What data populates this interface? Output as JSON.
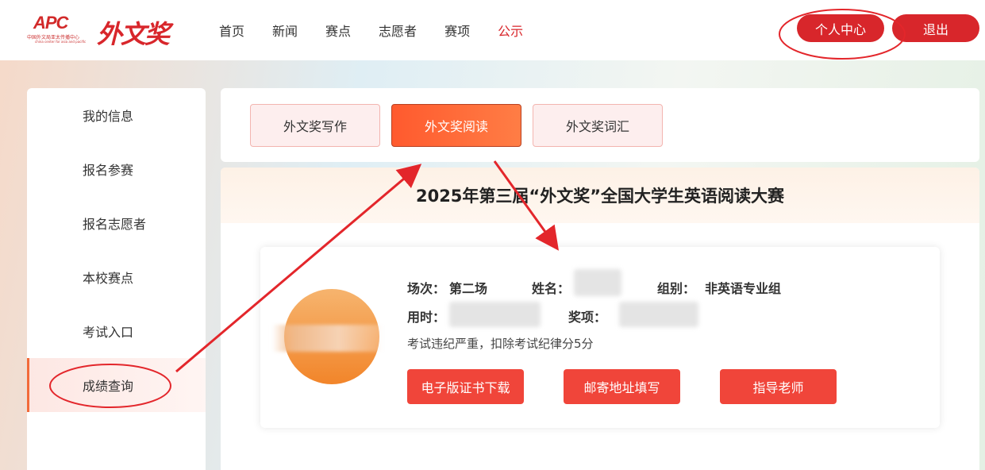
{
  "header": {
    "logo_apc": "APC",
    "logo_apc_sub": "中国外文局亚太传播中心",
    "logo_apc_sub2": "china center for asia and pacific",
    "logo_title": "外文奖",
    "nav": [
      {
        "label": "首页"
      },
      {
        "label": "新闻"
      },
      {
        "label": "赛点"
      },
      {
        "label": "志愿者"
      },
      {
        "label": "赛项"
      },
      {
        "label": "公示"
      }
    ],
    "user_center_label": "个人中心",
    "logout_label": "退出"
  },
  "sidebar": {
    "items": [
      {
        "label": "我的信息"
      },
      {
        "label": "报名参赛"
      },
      {
        "label": "报名志愿者"
      },
      {
        "label": "本校赛点"
      },
      {
        "label": "考试入口"
      },
      {
        "label": "成绩查询"
      }
    ],
    "active_index": 5
  },
  "tabs": [
    {
      "label": "外文奖写作"
    },
    {
      "label": "外文奖阅读"
    },
    {
      "label": "外文奖词汇"
    }
  ],
  "active_tab_index": 1,
  "main": {
    "title": "2025年第三届“外文奖”全国大学生英语阅读大赛",
    "result": {
      "session_label": "场次：",
      "session_value": "第二场",
      "name_label": "姓名：",
      "group_label": "组别：",
      "group_value": "非英语专业组",
      "time_label": "用时：",
      "award_label": "奖项：",
      "warning": "考试违纪严重，扣除考试纪律分5分"
    },
    "buttons": {
      "certificate": "电子版证书下载",
      "address": "邮寄地址填写",
      "teacher": "指导老师"
    }
  },
  "colors": {
    "brand_red": "#d8262b",
    "tab_active": "#ff6a36",
    "action_button": "#f0453a",
    "annotation": "#e3262b"
  }
}
